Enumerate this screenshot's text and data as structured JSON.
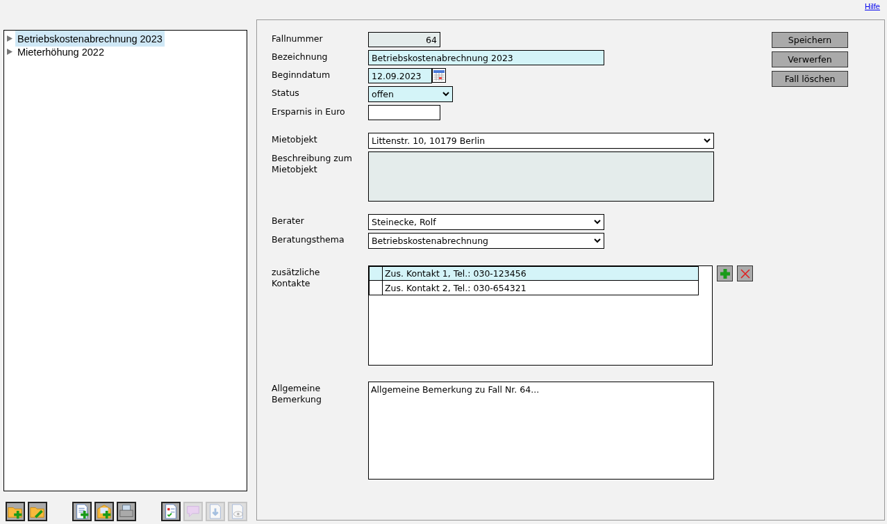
{
  "help_link": "Hilfe",
  "tree": {
    "items": [
      {
        "label": "Betriebskostenabrechnung 2023",
        "selected": true,
        "expanded": false
      },
      {
        "label": "Mieterhöhung 2022",
        "selected": false,
        "expanded": false
      }
    ]
  },
  "toolbar": [
    {
      "kind": "folder-add",
      "disabled": false
    },
    {
      "kind": "folder-edit",
      "disabled": false
    },
    {
      "kind": "gap"
    },
    {
      "kind": "document-add",
      "disabled": false
    },
    {
      "kind": "mail-add",
      "disabled": false
    },
    {
      "kind": "print",
      "disabled": false
    },
    {
      "kind": "gap"
    },
    {
      "kind": "checklist",
      "disabled": false
    },
    {
      "kind": "comment",
      "disabled": true
    },
    {
      "kind": "download",
      "disabled": true
    },
    {
      "kind": "view",
      "disabled": true
    }
  ],
  "sections": [
    {
      "fields": [
        {
          "label": "Fallnummer",
          "kind": "number",
          "readonly": true,
          "required": false,
          "value": "64"
        },
        {
          "label": "Bezeichnung",
          "kind": "text",
          "readonly": false,
          "required": true,
          "value": "Betriebskostenabrechnung 2023"
        },
        {
          "label": "Beginndatum",
          "kind": "date",
          "readonly": false,
          "required": true,
          "value": "12.09.2023"
        },
        {
          "label": "Status",
          "kind": "select",
          "readonly": false,
          "required": true,
          "value": "offen"
        },
        {
          "label": "Ersparnis in Euro",
          "kind": "text",
          "readonly": false,
          "required": false
        }
      ]
    },
    {
      "fields": [
        {
          "label": "Mietobjekt",
          "kind": "select",
          "readonly": false,
          "required": false,
          "value": "Littenstr. 10, 10179 Berlin"
        },
        {
          "label": "Beschreibung zum Mietobjekt",
          "kind": "textarea",
          "readonly": true,
          "required": false
        }
      ]
    },
    {
      "fields": [
        {
          "label": "Berater",
          "kind": "select",
          "readonly": false,
          "required": false,
          "value": "Steinecke, Rolf"
        },
        {
          "label": "Beratungsthema",
          "kind": "select",
          "readonly": false,
          "required": false,
          "value": "Betriebskostenabrechnung"
        }
      ]
    }
  ],
  "contacts": {
    "label": "zusätzliche Kontakte",
    "items": [
      {
        "text": "Zus. Kontakt 1, Tel.: 030-123456",
        "selected": true
      },
      {
        "text": "Zus. Kontakt 2, Tel.: 030-654321",
        "selected": false
      }
    ]
  },
  "remark": {
    "label": "Allgemeine Bemerkung",
    "value": "Allgemeine Bemerkung zu Fall Nr. 64..."
  },
  "buttons": [
    "Speichern",
    "Verwerfen",
    "Fall löschen"
  ]
}
